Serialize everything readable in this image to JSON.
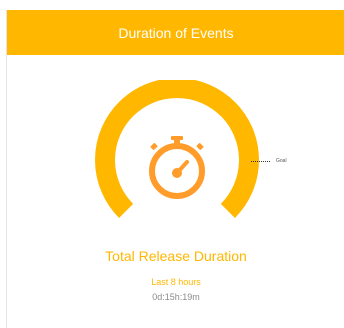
{
  "widget": {
    "title": "Duration of Events",
    "header_color": "#ffb700"
  },
  "gauge": {
    "icon": "stopwatch-icon",
    "arc_color": "#ffb700",
    "icon_color": "#ff9c2a",
    "goal_label": "Goal"
  },
  "metric": {
    "title": "Total Release Duration",
    "period": "Last 8 hours",
    "value": "0d:15h:19m"
  }
}
